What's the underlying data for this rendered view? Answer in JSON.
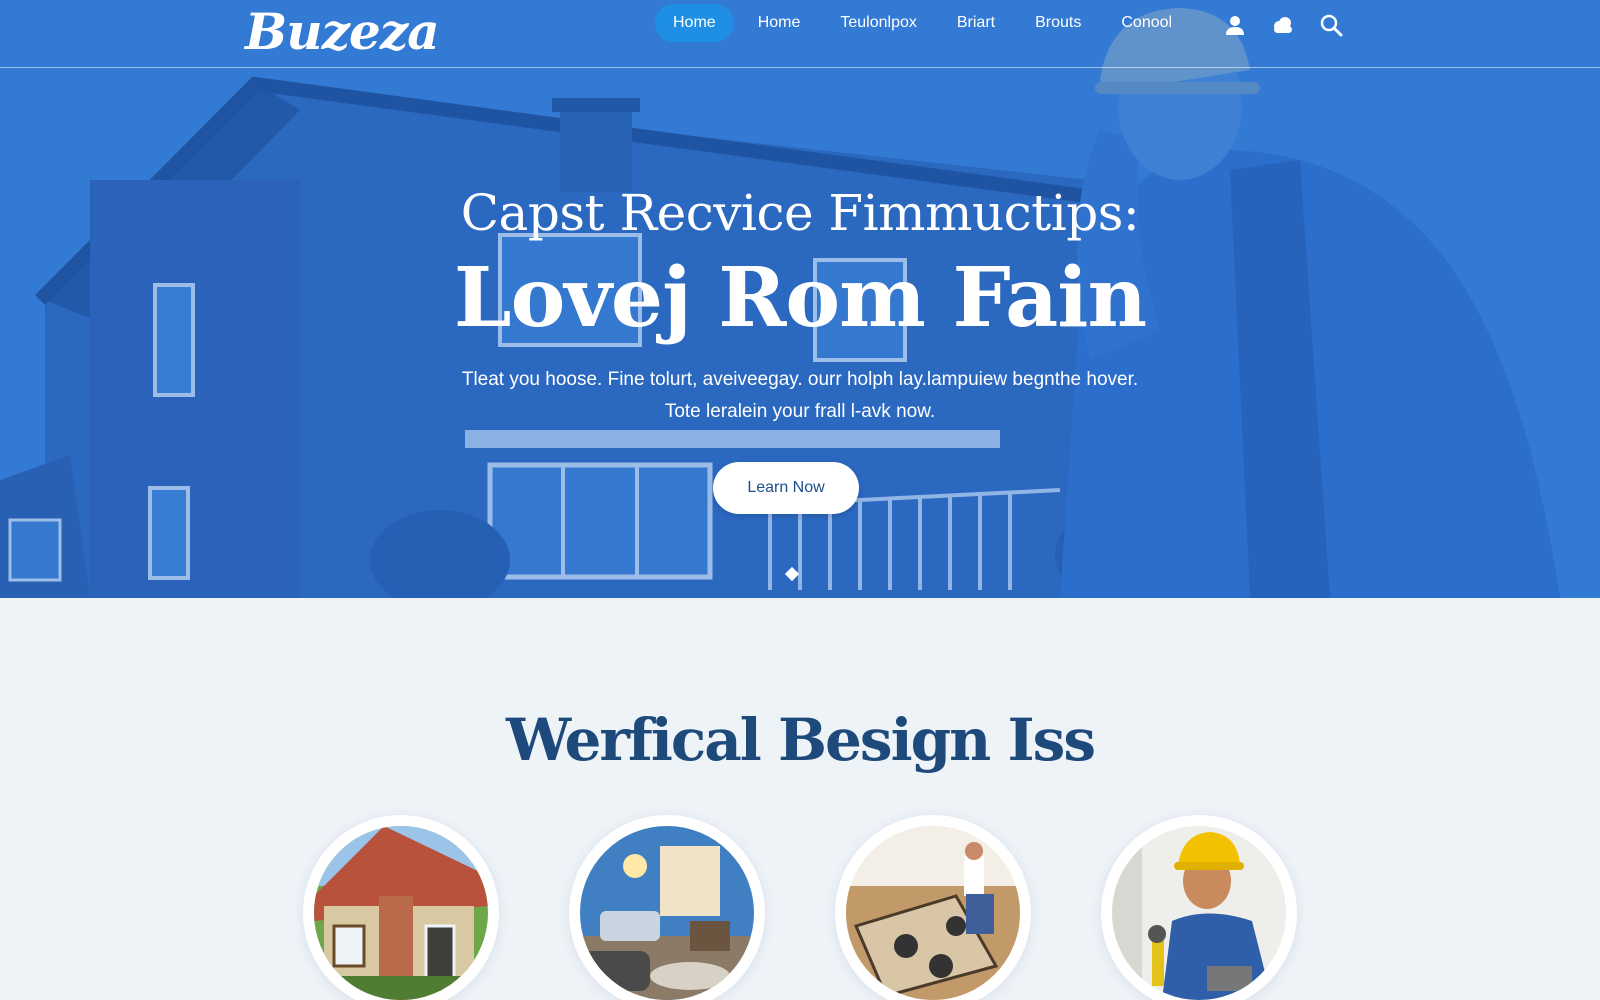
{
  "brand": {
    "logo": "Buzeza"
  },
  "nav": {
    "links": [
      "Home",
      "Home",
      "Teulonlpox",
      "Briart",
      "Brouts",
      "Conool"
    ],
    "active_index": 0,
    "icons": [
      "user-icon",
      "cloud-icon",
      "search-icon"
    ]
  },
  "hero": {
    "title_line1": "Capst Recvice Fimmuctips:",
    "title_line2": "Lovej Rom Fain",
    "subtitle_line1": "Tleat you hoose. Fine tolurt, aveiveegay. ourr holph lay.lampuiew begnthe hover.",
    "subtitle_line2": "Tote leralein your frall l-avk now.",
    "cta": "Learn Now",
    "slides": 1
  },
  "section": {
    "title": "Werfical Besign Iss",
    "cards": [
      "house-exterior-photo",
      "living-room-photo",
      "floor-install-photo",
      "plumber-worker-photo"
    ]
  },
  "colors": {
    "hero_blue": "#2a6cc4",
    "nav_active": "#1f8fe6",
    "heading_navy": "#1d4a7a",
    "page_bg": "#eef3f8"
  }
}
